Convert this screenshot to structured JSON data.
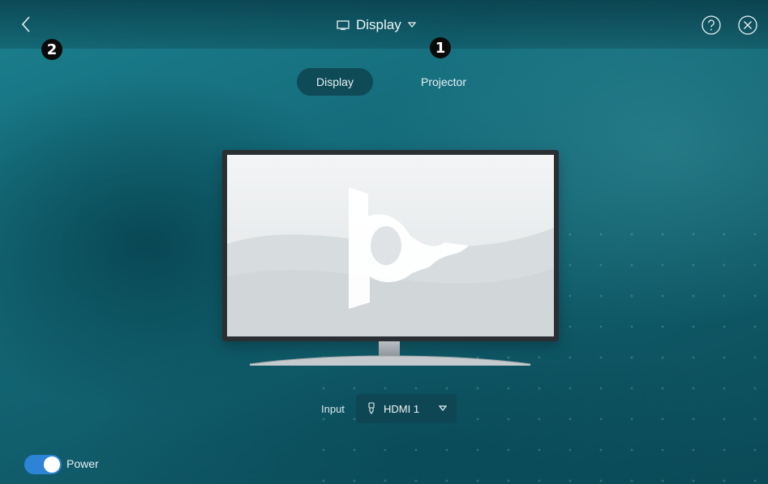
{
  "header": {
    "title": "Display",
    "icons": {
      "back": "chevron-left-icon",
      "display": "monitor-icon",
      "dropdown": "caret-down-icon",
      "help": "help-icon",
      "close": "close-icon"
    }
  },
  "callouts": {
    "one": "1",
    "two": "2"
  },
  "tabs": [
    {
      "label": "Display",
      "selected": true
    },
    {
      "label": "Projector",
      "selected": false
    }
  ],
  "input": {
    "label": "Input",
    "value": "HDMI 1",
    "icon": "hdmi-plug-icon"
  },
  "power": {
    "label": "Power",
    "on": true
  },
  "colors": {
    "background": "#156c7b",
    "selected_tab": "#0f4a57",
    "toggle_on": "#2d83d6"
  }
}
